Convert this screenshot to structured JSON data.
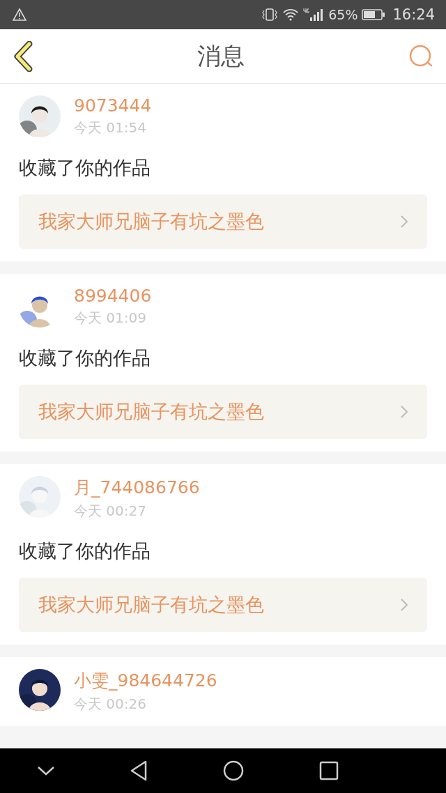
{
  "status_bar": {
    "battery": "65%",
    "time": "16:24"
  },
  "header": {
    "title": "消息"
  },
  "messages": [
    {
      "user": "9073444",
      "time": "今天 01:54",
      "action": "收藏了你的作品",
      "work": "我家大师兄脑子有坑之墨色"
    },
    {
      "user": "8994406",
      "time": "今天 01:09",
      "action": "收藏了你的作品",
      "work": "我家大师兄脑子有坑之墨色"
    },
    {
      "user": "月_744086766",
      "time": "今天 00:27",
      "action": "收藏了你的作品",
      "work": "我家大师兄脑子有坑之墨色"
    },
    {
      "user": "小雯_984644726",
      "time": "今天 00:26"
    }
  ]
}
